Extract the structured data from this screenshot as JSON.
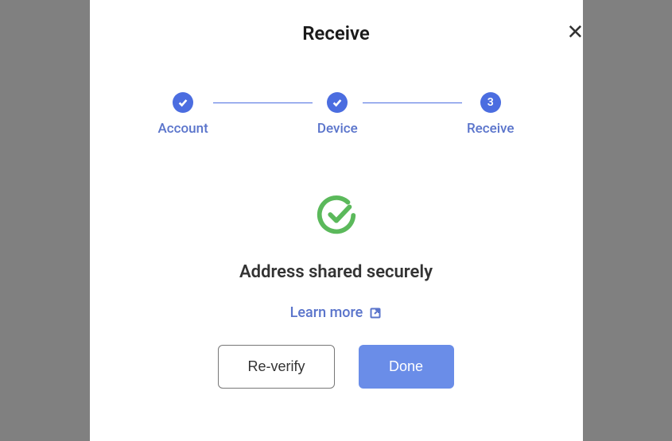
{
  "modal": {
    "title": "Receive"
  },
  "stepper": {
    "steps": [
      {
        "label": "Account",
        "done": true
      },
      {
        "label": "Device",
        "done": true
      },
      {
        "label": "Receive",
        "number": "3"
      }
    ]
  },
  "success": {
    "title": "Address shared securely",
    "learn_more": "Learn more"
  },
  "buttons": {
    "reverify": "Re-verify",
    "done": "Done"
  },
  "colors": {
    "accent": "#4b6de0",
    "success": "#4caf50",
    "primary_button": "#6a8de8"
  }
}
